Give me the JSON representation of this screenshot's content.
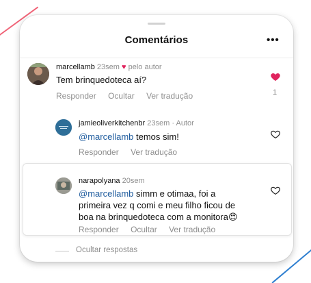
{
  "header": {
    "title": "Comentários",
    "more_label": "•••"
  },
  "comments": [
    {
      "username": "marcellamb",
      "time": "23sem",
      "badge": "pelo autor",
      "text": "Tem brinquedoteca aí?",
      "actions": [
        "Responder",
        "Ocultar",
        "Ver tradução"
      ],
      "liked": true,
      "like_count": "1"
    },
    {
      "username": "jamieoliverkitchenbr",
      "time": "23sem",
      "badge": "Autor",
      "mention": "@marcellamb",
      "text": "temos sim!",
      "actions": [
        "Responder",
        "Ver tradução"
      ],
      "liked": false
    },
    {
      "username": "narapolyana",
      "time": "20sem",
      "mention": "@marcellamb",
      "text_lines": [
        "simm e otimaa, foi a",
        "primeira vez q comi e meu filho ficou de",
        "boa na brinquedoteca com a monitora😍"
      ],
      "actions": [
        "Responder",
        "Ocultar",
        "Ver tradução"
      ],
      "liked": false
    }
  ],
  "footer": {
    "hide_replies_label": "Ocultar respostas"
  },
  "colors": {
    "like_red": "#e0245e",
    "mention_blue": "#1f5c9e",
    "muted_gray": "#8e8e8e"
  },
  "icons": [
    "heart-icon",
    "more-options-icon"
  ]
}
